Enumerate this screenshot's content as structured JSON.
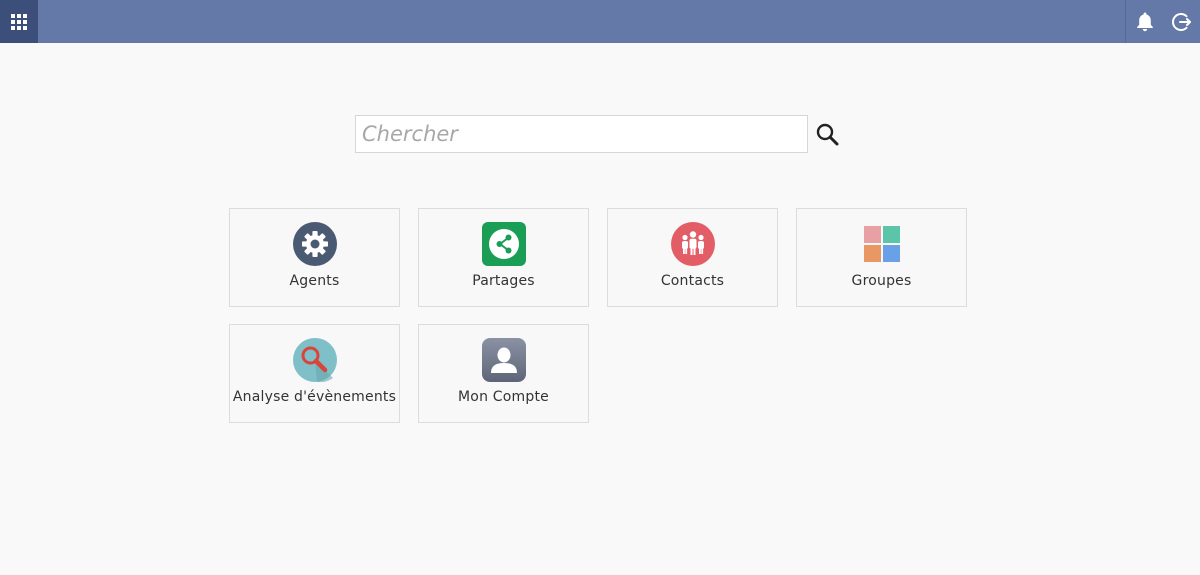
{
  "header": {
    "apps_icon": "grid-icon",
    "notifications_icon": "bell-icon",
    "logout_icon": "logout-icon",
    "bar_color": "#6579a9",
    "apps_color": "#3b4f7a"
  },
  "search": {
    "placeholder": "Chercher",
    "value": "",
    "icon": "search-icon"
  },
  "apps": [
    {
      "label": "Agents",
      "icon": "gear-icon",
      "color": "#4b5a73"
    },
    {
      "label": "Partages",
      "icon": "share-icon",
      "color": "#1a9d55"
    },
    {
      "label": "Contacts",
      "icon": "people-icon",
      "color": "#e35d67"
    },
    {
      "label": "Groupes",
      "icon": "squares-icon",
      "color": "#e8a0a4"
    },
    {
      "label": "Analyse d'évènements",
      "icon": "magnifier-icon",
      "color": "#7fbfc7"
    },
    {
      "label": "Mon Compte",
      "icon": "user-icon",
      "color": "#6e7587"
    }
  ]
}
